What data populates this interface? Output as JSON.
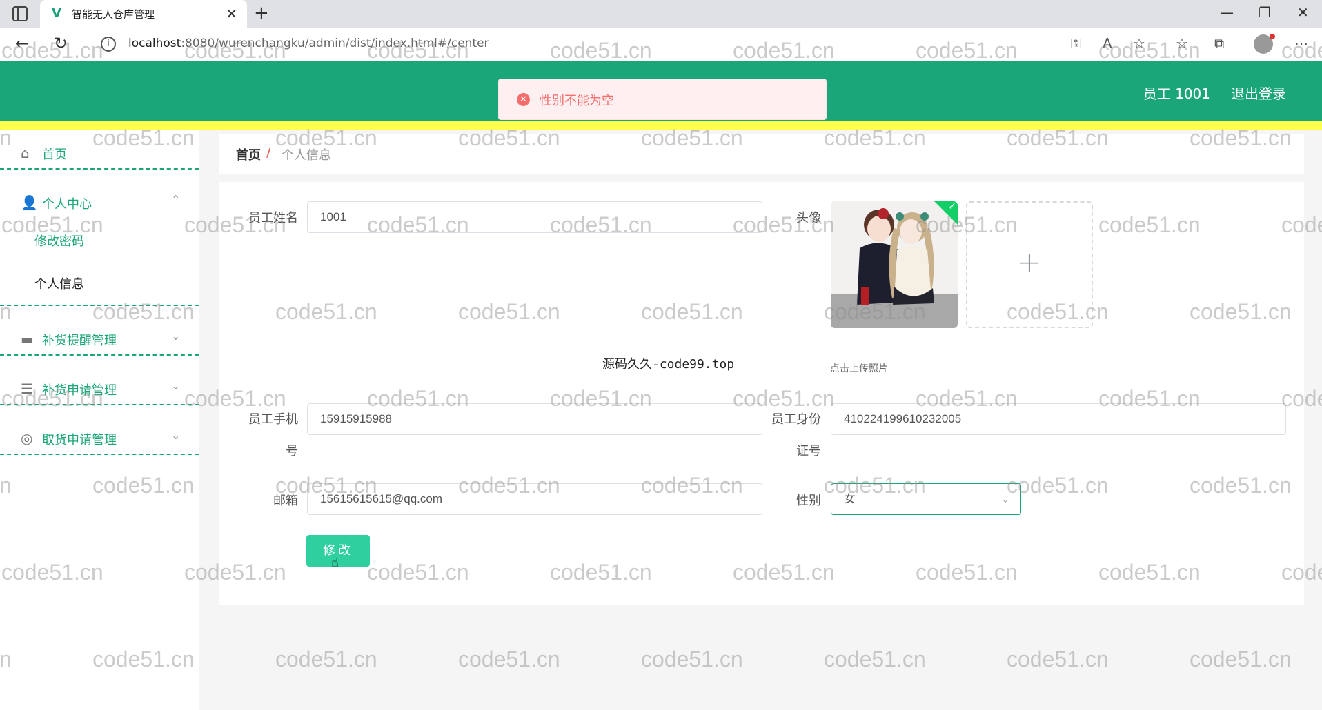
{
  "browser": {
    "tab_title": "智能无人仓库管理",
    "url_host": "localhost",
    "url_rest": ":8080/wurenchangku/admin/dist/index.html#/center"
  },
  "header": {
    "user": "员工 1001",
    "logout": "退出登录"
  },
  "toast": {
    "message": "性别不能为空"
  },
  "sidebar": {
    "home": "首页",
    "personal_center": "个人中心",
    "change_password": "修改密码",
    "personal_info": "个人信息",
    "restock_reminder": "补货提醒管理",
    "restock_request": "补货申请管理",
    "pickup_request": "取货申请管理"
  },
  "breadcrumb": {
    "home": "首页",
    "sep": "/",
    "current": "个人信息"
  },
  "form": {
    "name_label": "员工姓名",
    "name_value": "1001",
    "avatar_label": "头像",
    "upload_tip": "点击上传照片",
    "phone_label_1": "员工手机",
    "phone_label_2": "号",
    "phone_value": "15915915988",
    "id_label_1": "员工身份",
    "id_label_2": "证号",
    "id_value": "410224199610232005",
    "email_label": "邮箱",
    "email_value": "15615615615@qq.com",
    "gender_label": "性别",
    "gender_value": "女",
    "submit": "修改"
  },
  "overlay_text": "源码久久-code99.top",
  "watermark": "code51.cn"
}
